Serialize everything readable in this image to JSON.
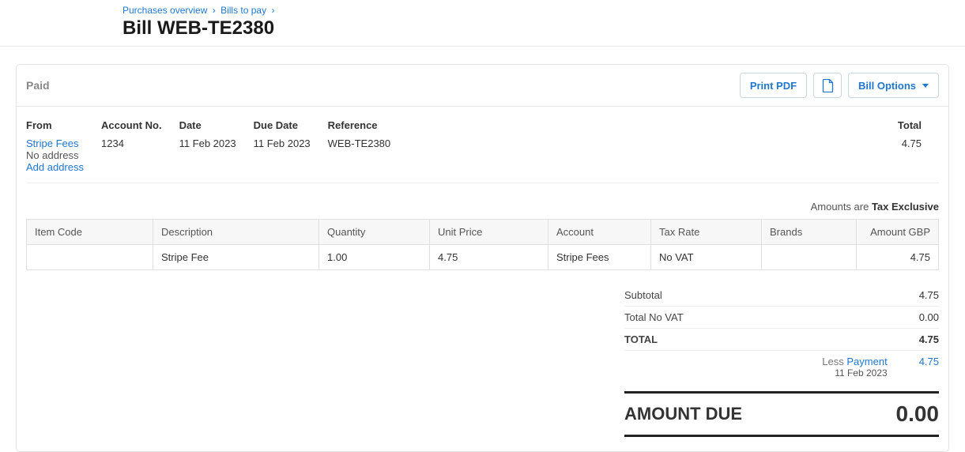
{
  "breadcrumb": {
    "items": [
      "Purchases overview",
      "Bills to pay"
    ],
    "sep": "›"
  },
  "page_title": "Bill WEB-TE2380",
  "status": "Paid",
  "actions": {
    "print": "Print PDF",
    "options": "Bill Options"
  },
  "meta": {
    "headers": {
      "from": "From",
      "account_no": "Account No.",
      "date": "Date",
      "due_date": "Due Date",
      "reference": "Reference",
      "total": "Total"
    },
    "from_name": "Stripe Fees",
    "from_noaddr": "No address",
    "from_addaddr": "Add address",
    "account_no": "1234",
    "date": "11 Feb 2023",
    "due_date": "11 Feb 2023",
    "reference": "WEB-TE2380",
    "total": "4.75"
  },
  "tax_note": {
    "prefix": "Amounts are ",
    "mode": "Tax Exclusive"
  },
  "columns": {
    "item_code": "Item Code",
    "description": "Description",
    "quantity": "Quantity",
    "unit_price": "Unit Price",
    "account": "Account",
    "tax_rate": "Tax Rate",
    "brands": "Brands",
    "amount": "Amount GBP"
  },
  "rows": [
    {
      "item_code": "",
      "description": "Stripe Fee",
      "quantity": "1.00",
      "unit_price": "4.75",
      "account": "Stripe Fees",
      "tax_rate": "No VAT",
      "brands": "",
      "amount": "4.75"
    }
  ],
  "totals": {
    "subtotal_label": "Subtotal",
    "subtotal": "4.75",
    "novat_label": "Total No VAT",
    "novat": "0.00",
    "total_label": "TOTAL",
    "total": "4.75",
    "less_label": "Less",
    "payment_label": "Payment",
    "payment_date": "11 Feb 2023",
    "payment_amount": "4.75",
    "amount_due_label": "AMOUNT DUE",
    "amount_due": "0.00"
  }
}
